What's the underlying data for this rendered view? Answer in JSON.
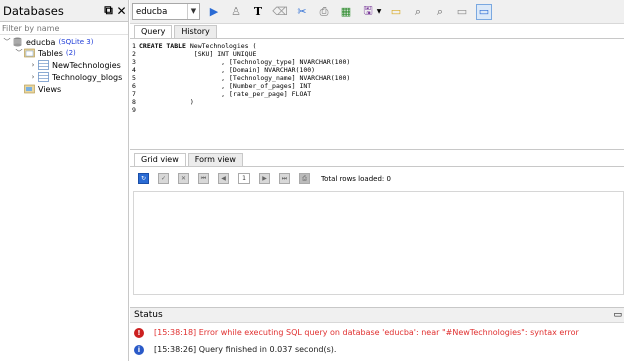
{
  "databases_panel": {
    "title": "Databases",
    "filter_placeholder": "Filter by name",
    "tree": {
      "db_name": "educba",
      "db_type": "(SQLite 3)",
      "tables_label": "Tables",
      "tables_count": "(2)",
      "tables": [
        "NewTechnologies",
        "Technology_blogs"
      ],
      "views_label": "Views"
    }
  },
  "toolbar": {
    "database_select": "educba"
  },
  "editor": {
    "tabs": [
      "Query",
      "History"
    ],
    "lines": [
      {
        "num": "1",
        "kw": "CREATE TABLE",
        "text": " NewTechnologies ("
      },
      {
        "num": "2",
        "kw": "",
        "text": "              [SKU] INT UNIQUE"
      },
      {
        "num": "3",
        "kw": "",
        "text": "                     , [Technology_type] NVARCHAR(100)"
      },
      {
        "num": "4",
        "kw": "",
        "text": "                     , [Domain] NVARCHAR(100)"
      },
      {
        "num": "5",
        "kw": "",
        "text": "                     , [Technology_name] NVARCHAR(100)"
      },
      {
        "num": "6",
        "kw": "",
        "text": "                     , [Number_of_pages] INT"
      },
      {
        "num": "7",
        "kw": "",
        "text": "                     , [rate_per_page] FLOAT"
      },
      {
        "num": "8",
        "kw": "",
        "text": "             )"
      },
      {
        "num": "9",
        "kw": "",
        "text": ""
      }
    ]
  },
  "results": {
    "tabs": [
      "Grid view",
      "Form view"
    ],
    "page_number": "1",
    "rows_loaded": "Total rows loaded: 0"
  },
  "status": {
    "title": "Status",
    "messages": [
      {
        "type": "error",
        "text": "[15:38:18]  Error while executing SQL query on database 'educba': near \"#NewTechnologies\": syntax error",
        "color": "#e03030"
      },
      {
        "type": "info",
        "text": "[15:38:26]  Query finished in 0.037 second(s).",
        "color": "#1a1a1a"
      }
    ]
  }
}
